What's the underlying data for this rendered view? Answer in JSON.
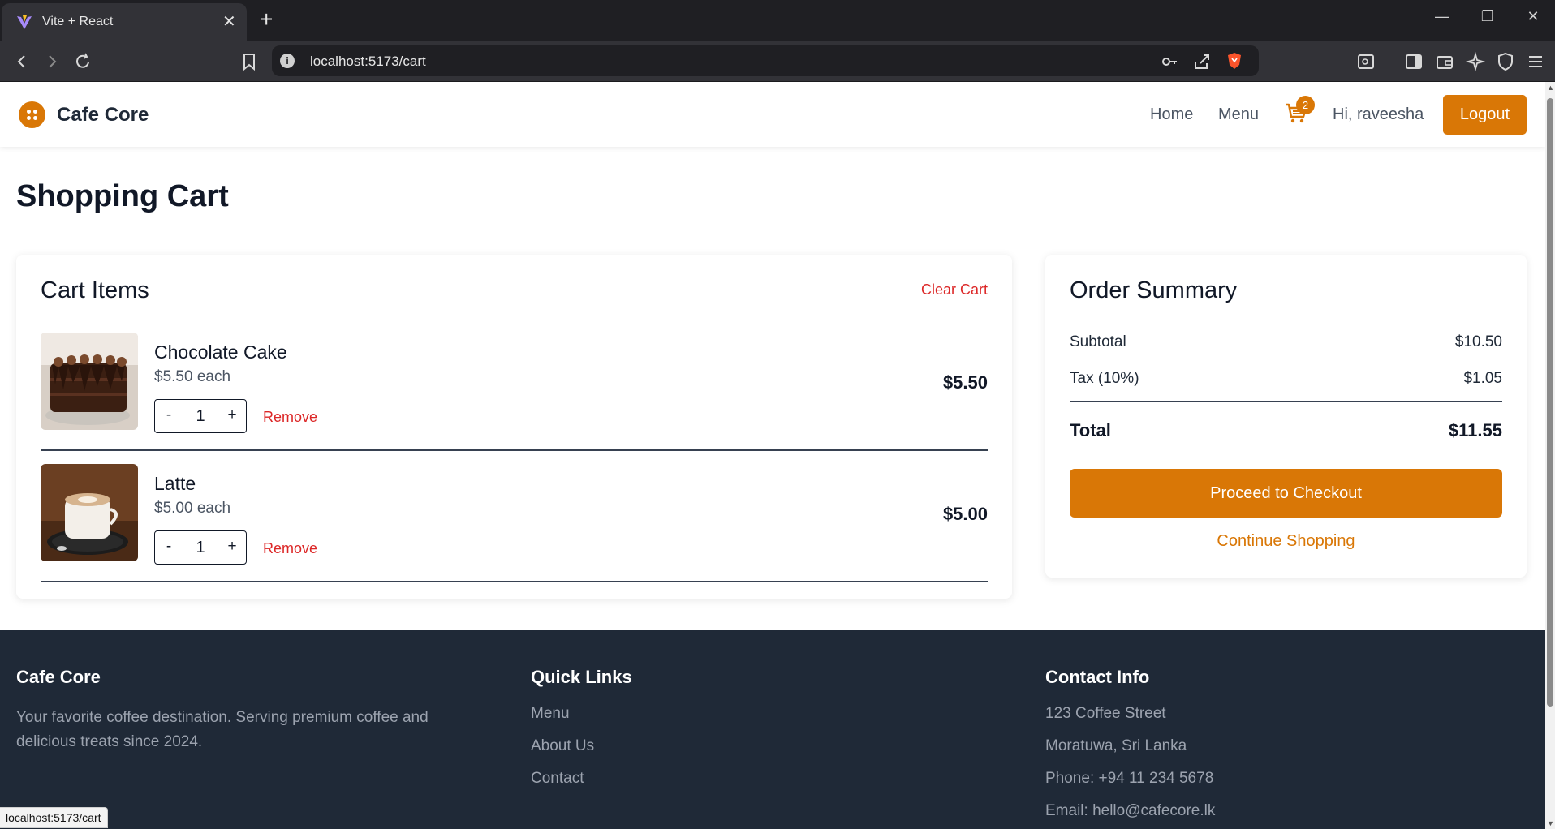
{
  "browser": {
    "tab_title": "Vite + React",
    "url": "localhost:5173/cart",
    "status_url": "localhost:5173/cart"
  },
  "site": {
    "brand": "Cafe Core",
    "nav": {
      "home": "Home",
      "menu": "Menu",
      "cart_count": "2",
      "greeting": "Hi, raveesha",
      "logout": "Logout"
    }
  },
  "page": {
    "title": "Shopping Cart"
  },
  "cart": {
    "title": "Cart Items",
    "clear_label": "Clear Cart",
    "remove_label": "Remove",
    "minus": "-",
    "plus": "+",
    "items": [
      {
        "name": "Chocolate Cake",
        "each": "$5.50 each",
        "qty": "1",
        "total": "$5.50"
      },
      {
        "name": "Latte",
        "each": "$5.00 each",
        "qty": "1",
        "total": "$5.00"
      }
    ]
  },
  "summary": {
    "title": "Order Summary",
    "subtotal_label": "Subtotal",
    "subtotal": "$10.50",
    "tax_label": "Tax (10%)",
    "tax": "$1.05",
    "total_label": "Total",
    "total": "$11.55",
    "checkout_label": "Proceed to Checkout",
    "continue_label": "Continue Shopping"
  },
  "footer": {
    "brand": "Cafe Core",
    "description": "Your favorite coffee destination. Serving premium coffee and delicious treats since 2024.",
    "links_title": "Quick Links",
    "links": [
      "Menu",
      "About Us",
      "Contact"
    ],
    "contact_title": "Contact Info",
    "address1": "123 Coffee Street",
    "address2": "Moratuwa, Sri Lanka",
    "phone": "Phone: +94 11 234 5678",
    "email": "Email: hello@cafecore.lk"
  },
  "colors": {
    "accent": "#d97706",
    "danger": "#dc2626",
    "footer_bg": "#1f2937"
  }
}
